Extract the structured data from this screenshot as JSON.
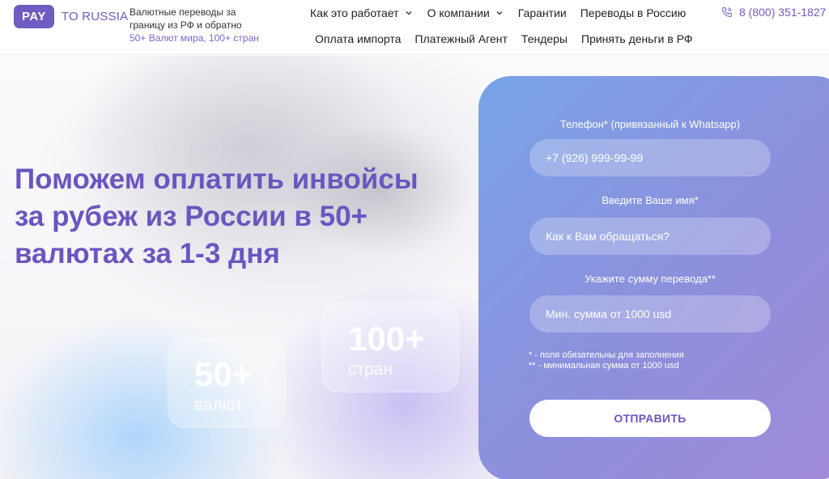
{
  "header": {
    "logo": {
      "pay": "PAY",
      "rest": "TO RUSSIA"
    },
    "tagline": "Валютные переводы за границу из РФ и обратно",
    "tagline_sub": "50+ Валют мира, 100+ стран",
    "nav_row1": [
      {
        "label": "Как это работает",
        "dropdown": true
      },
      {
        "label": "О компании",
        "dropdown": true
      },
      {
        "label": "Гарантии",
        "dropdown": false
      },
      {
        "label": "Переводы в Россию",
        "dropdown": false
      }
    ],
    "nav_row2": [
      {
        "label": "Оплата импорта"
      },
      {
        "label": "Платежный Агент"
      },
      {
        "label": "Тендеры"
      },
      {
        "label": "Принять деньги в РФ"
      }
    ],
    "phone": "8 (800) 351-1827"
  },
  "hero": {
    "title": "Поможем оплатить инвойсы за рубеж из России в 50+ валютах за 1-3 дня",
    "stats": [
      {
        "number": "50+",
        "label": "валют"
      },
      {
        "number": "100+",
        "label": "стран"
      }
    ]
  },
  "form": {
    "phone_label": "Телефон* (привязанный к Whatsapp)",
    "phone_placeholder": "+7 (926) 999-99-99",
    "name_label": "Введите Ваше имя*",
    "name_placeholder": "Как к Вам обращаться?",
    "amount_label": "Укажите сумму перевода**",
    "amount_placeholder": "Мин. сумма от 1000 usd",
    "note1": "* - поля обязательны для заполнения",
    "note2": "** - минимальная сумма от 1000 usd",
    "submit": "ОТПРАВИТЬ"
  },
  "colors": {
    "brand": "#6f5bc2",
    "title": "#6a56bf",
    "panel_start": "#79a3e8",
    "panel_end": "#a18ad8"
  }
}
